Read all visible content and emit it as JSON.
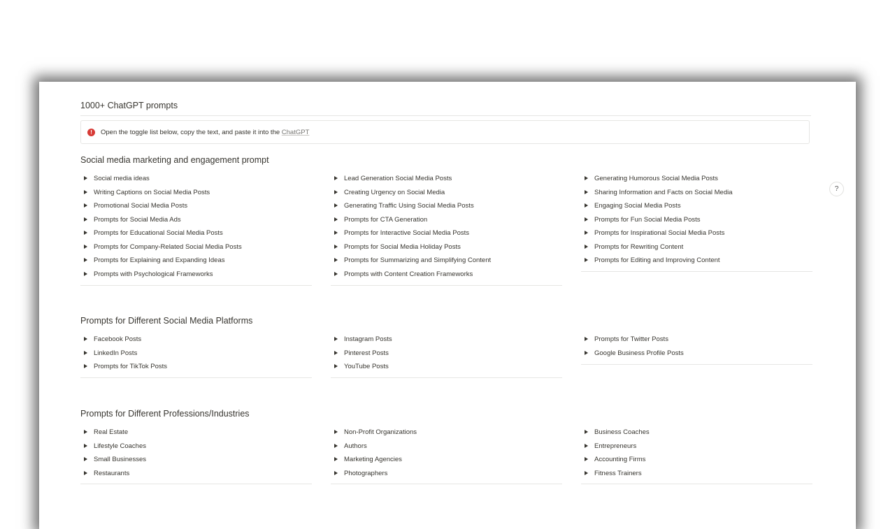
{
  "page": {
    "title": "1000+ ChatGPT prompts"
  },
  "callout": {
    "icon": "exclamation-circle-icon",
    "text": "Open the toggle list below, copy the text, and paste it into the ",
    "link": "ChatGPT",
    "icon_color": "#d73a35"
  },
  "help_button": {
    "label": "?"
  },
  "sections": [
    {
      "heading": "Social media marketing and engagement prompt",
      "columns": [
        [
          "Social media ideas",
          "Writing Captions on Social Media Posts",
          "Promotional Social Media Posts",
          "Prompts for Social Media Ads",
          "Prompts for Educational Social Media Posts",
          "Prompts for Company-Related Social Media Posts",
          "Prompts for Explaining and Expanding Ideas",
          "Prompts with Psychological Frameworks"
        ],
        [
          "Lead Generation Social Media Posts",
          "Creating Urgency on Social Media",
          "Generating Traffic Using Social Media Posts",
          "Prompts for CTA Generation",
          "Prompts for Interactive Social Media Posts",
          "Prompts for Social Media Holiday Posts",
          "Prompts for Summarizing and Simplifying Content",
          "Prompts with Content Creation Frameworks"
        ],
        [
          "Generating Humorous Social Media Posts",
          "Sharing Information and Facts on Social Media",
          "Engaging Social Media Posts",
          "Prompts for Fun Social Media Posts",
          "Prompts for Inspirational Social Media Posts",
          "Prompts for Rewriting Content",
          "Prompts for Editing and Improving Content"
        ]
      ]
    },
    {
      "heading": "Prompts for Different Social Media Platforms",
      "columns": [
        [
          "Facebook Posts",
          "LinkedIn Posts",
          "Prompts for TikTok Posts"
        ],
        [
          "Instagram Posts",
          "Pinterest Posts",
          "YouTube Posts"
        ],
        [
          "Prompts for Twitter Posts",
          "Google Business Profile Posts"
        ]
      ]
    },
    {
      "heading": "Prompts for Different Professions/Industries",
      "columns": [
        [
          "Real Estate",
          "Lifestyle Coaches",
          "Small Businesses",
          "Restaurants"
        ],
        [
          "Non-Profit Organizations",
          "Authors",
          "Marketing Agencies",
          "Photographers"
        ],
        [
          "Business Coaches",
          "Entrepreneurs",
          "Accounting Firms",
          "Fitness Trainers"
        ]
      ]
    }
  ]
}
